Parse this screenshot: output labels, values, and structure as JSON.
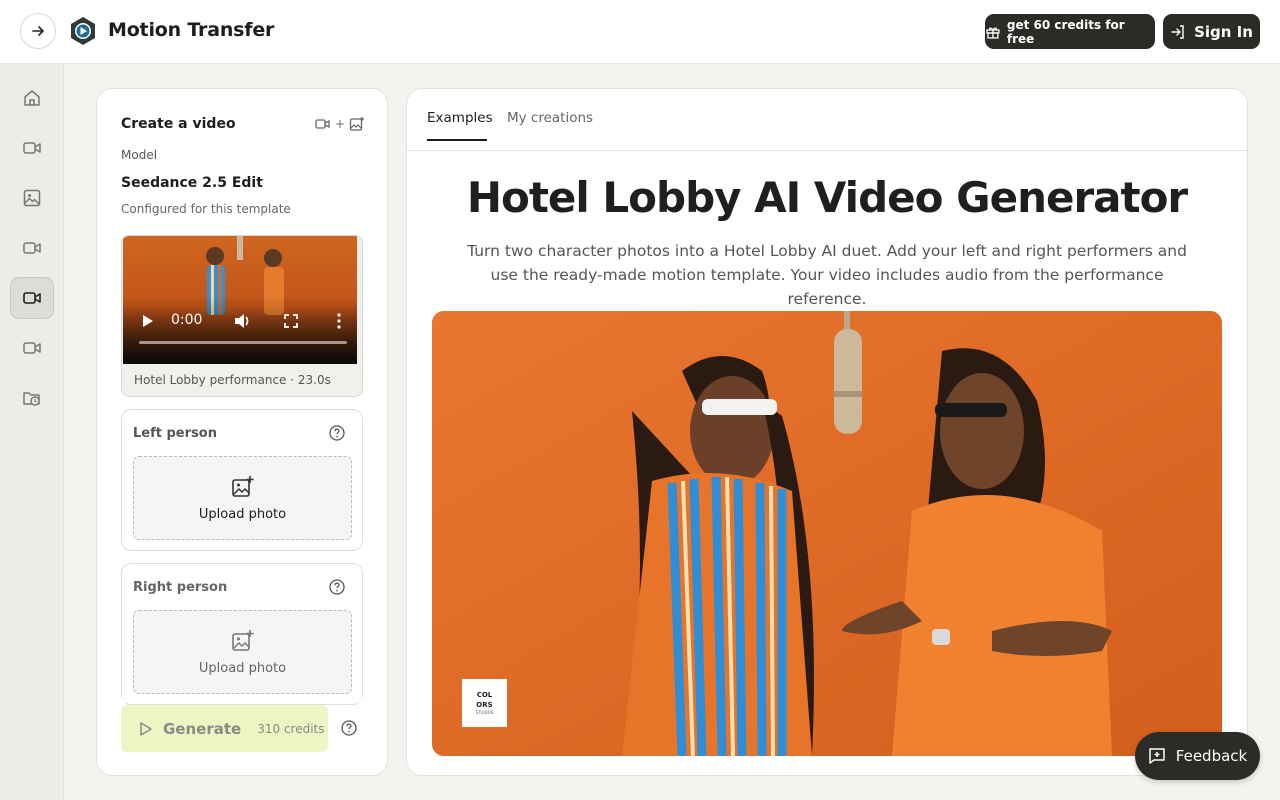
{
  "header": {
    "app_title": "Motion Transfer",
    "credits_label": "get 60 credits for free",
    "signin_label": "Sign In"
  },
  "sidebar": {
    "items": [
      {
        "icon": "home-icon"
      },
      {
        "icon": "video-camera-icon"
      },
      {
        "icon": "image-icon"
      },
      {
        "icon": "video-camera-icon"
      },
      {
        "icon": "video-camera-icon",
        "active": true
      },
      {
        "icon": "video-camera-icon"
      },
      {
        "icon": "history-folder-icon"
      }
    ]
  },
  "create_panel": {
    "title": "Create a video",
    "title_icons_plus": "+",
    "model_label": "Model",
    "model_name": "Seedance 2.5 Edit",
    "config_note": "Configured for this template",
    "video": {
      "time": "0:00",
      "caption": "Hotel Lobby performance · 23.0s"
    },
    "left_person": {
      "label": "Left person",
      "upload_label": "Upload photo"
    },
    "right_person": {
      "label": "Right person",
      "upload_label": "Upload photo"
    },
    "generate": {
      "label": "Generate",
      "credits": "310 credits"
    }
  },
  "main": {
    "tabs": [
      {
        "label": "Examples",
        "active": true
      },
      {
        "label": "My creations",
        "active": false
      }
    ],
    "hero_title": "Hotel Lobby AI Video Generator",
    "hero_subtitle": "Turn two character photos into a Hotel Lobby AI duet. Add your left and right performers and use the ready-made motion template. Your video includes audio from the performance reference.",
    "brand_tile": {
      "line1": "COL",
      "line2": "ORS",
      "line3": "STUDIOS"
    }
  },
  "feedback": {
    "label": "Feedback"
  },
  "colors": {
    "dark_button": "#2a2c27",
    "generate_bg": "#eef5c5",
    "hero_orange": "#df6c23"
  }
}
